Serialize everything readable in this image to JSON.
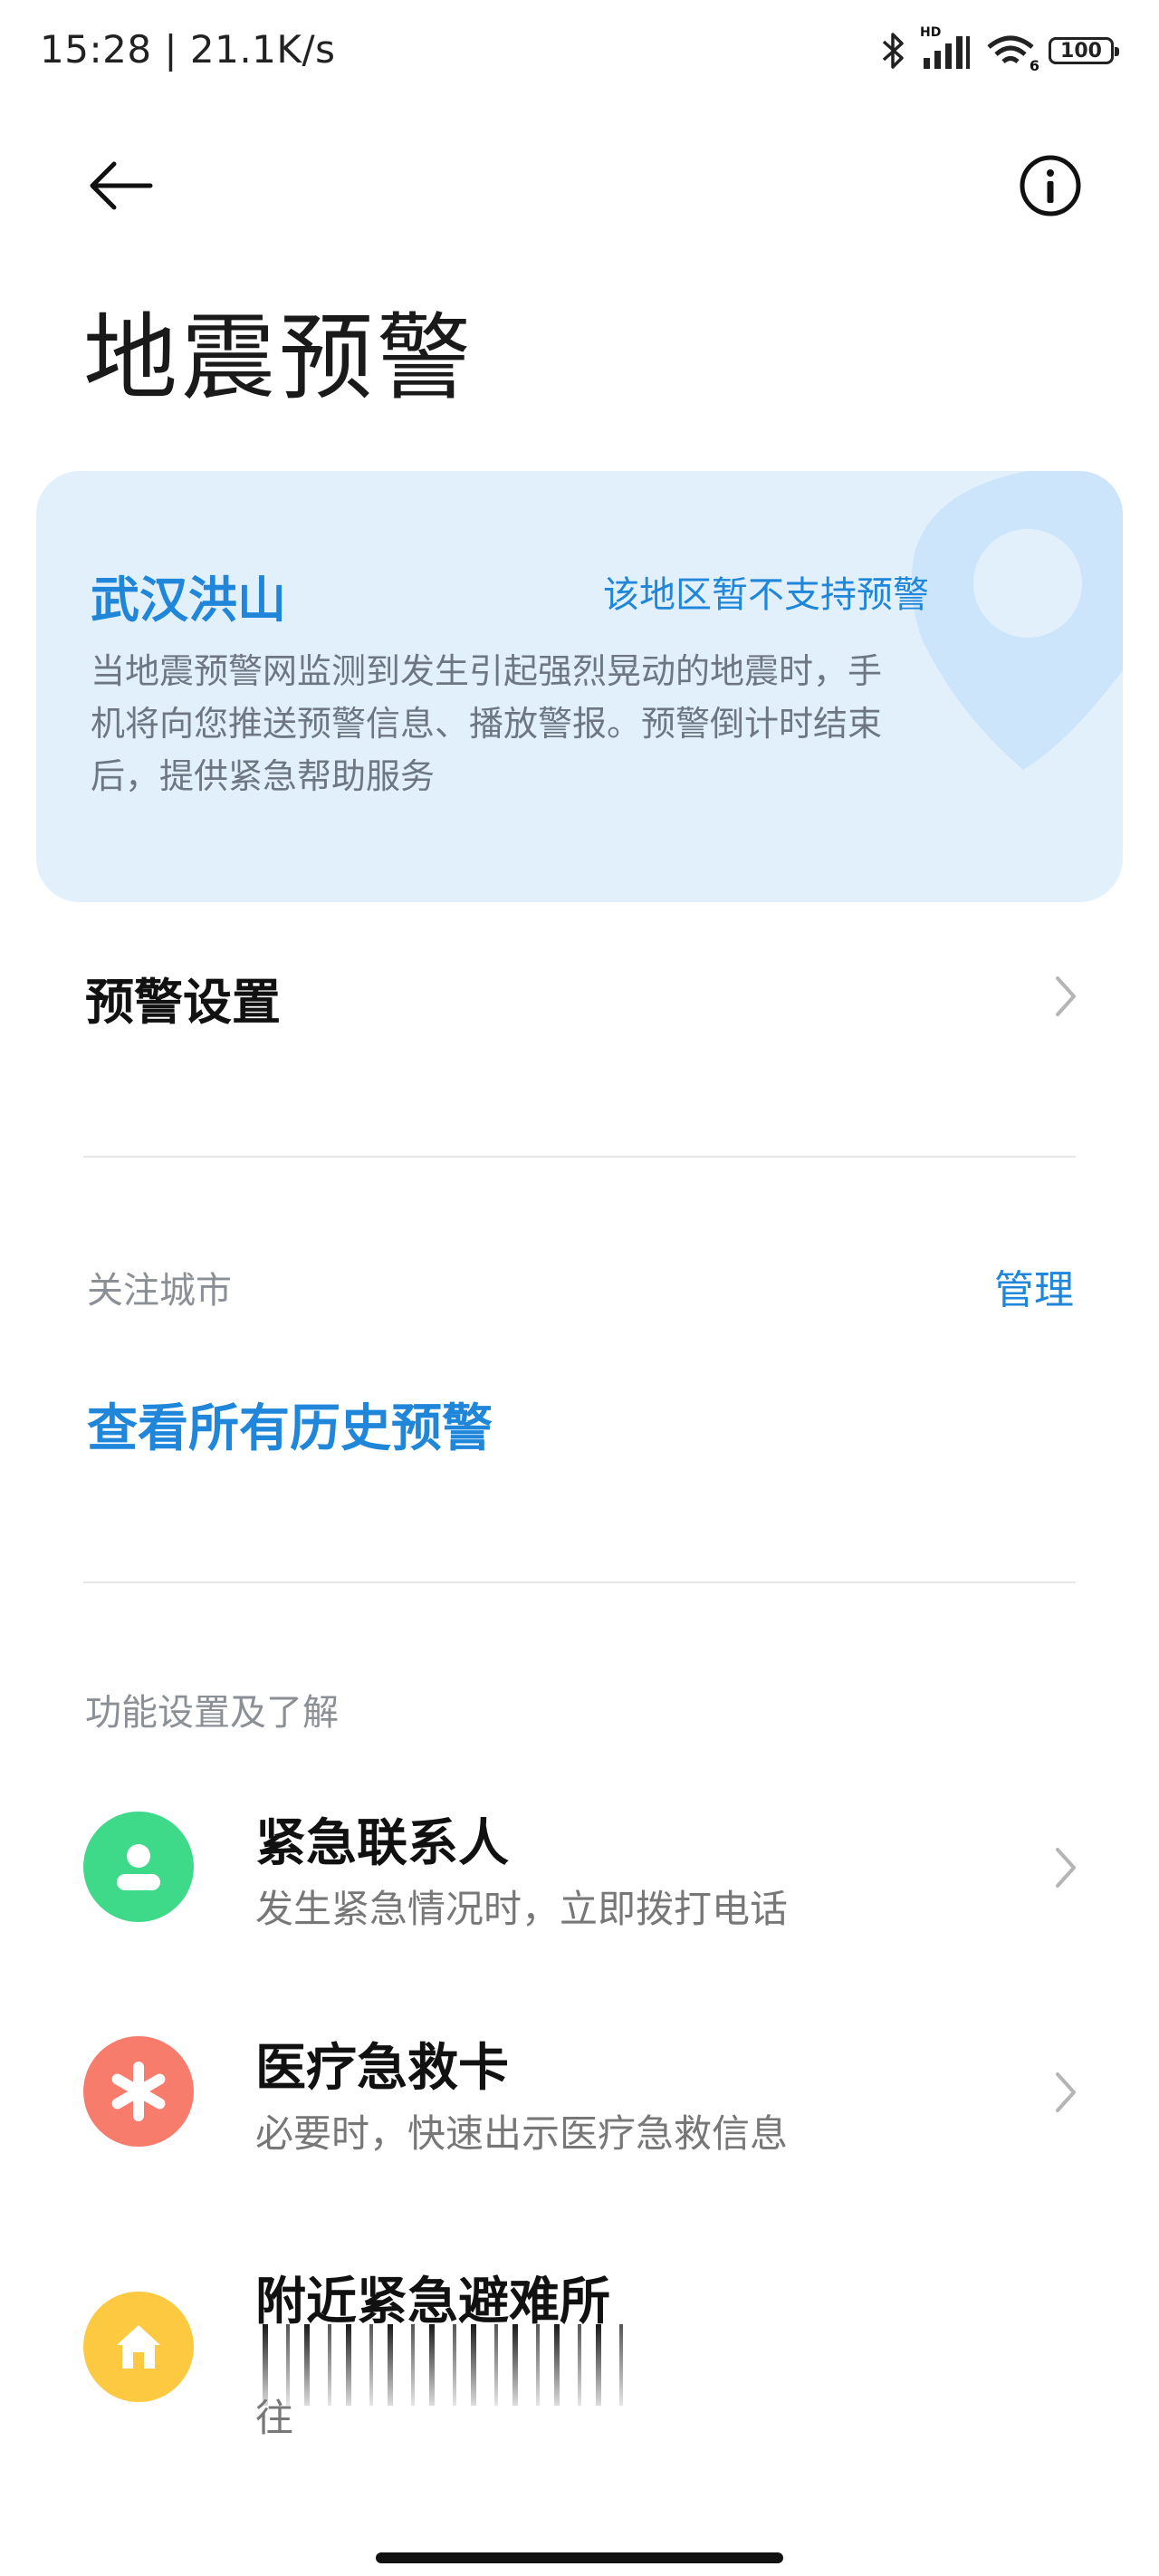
{
  "status_bar": {
    "time": "15:28 | 21.1K/s",
    "network_label": "HD",
    "wifi_label": "6",
    "battery": "100"
  },
  "header": {
    "title": "地震预警",
    "back_icon": "back-arrow-icon",
    "info_icon": "info-icon"
  },
  "info_card": {
    "location": "武汉洪山",
    "status": "该地区暂不支持预警",
    "description": "当地震预警网监测到发生引起强烈晃动的地震时，手机将向您推送预警信息、播放警报。预警倒计时结束后，提供紧急帮助服务",
    "background_color": "#e2f0fc",
    "accent_color": "#1f86da"
  },
  "settings": {
    "alert_settings_label": "预警设置"
  },
  "followed_cities": {
    "section_label": "关注城市",
    "manage_label": "管理",
    "history_link": "查看所有历史预警"
  },
  "features": {
    "section_label": "功能设置及了解",
    "items": [
      {
        "title": "紧急联系人",
        "subtitle": "发生紧急情况时，立即拨打电话",
        "icon": "person-icon",
        "color": "#3fd98a"
      },
      {
        "title": "医疗急救卡",
        "subtitle": "必要时，快速出示医疗急救信息",
        "icon": "asterisk-icon",
        "color": "#f87c6c"
      },
      {
        "title": "附近紧急避难所",
        "subtitle": "往",
        "icon": "house-icon",
        "color": "#fdc941"
      }
    ]
  }
}
